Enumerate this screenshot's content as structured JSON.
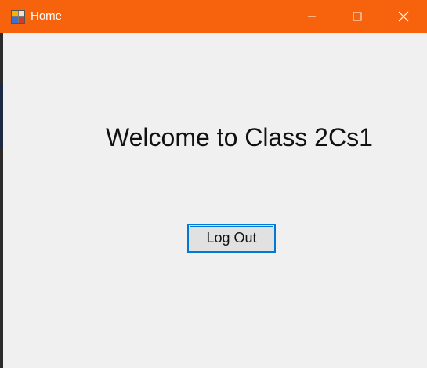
{
  "window": {
    "title": "Home",
    "accent_color": "#f7630c",
    "icon": "app-form-icon",
    "controls": {
      "minimize_icon": "minimize-icon",
      "maximize_icon": "maximize-icon",
      "close_icon": "close-icon"
    }
  },
  "main": {
    "welcome_text": "Welcome to Class 2Cs1",
    "logout_label": "Log Out"
  }
}
